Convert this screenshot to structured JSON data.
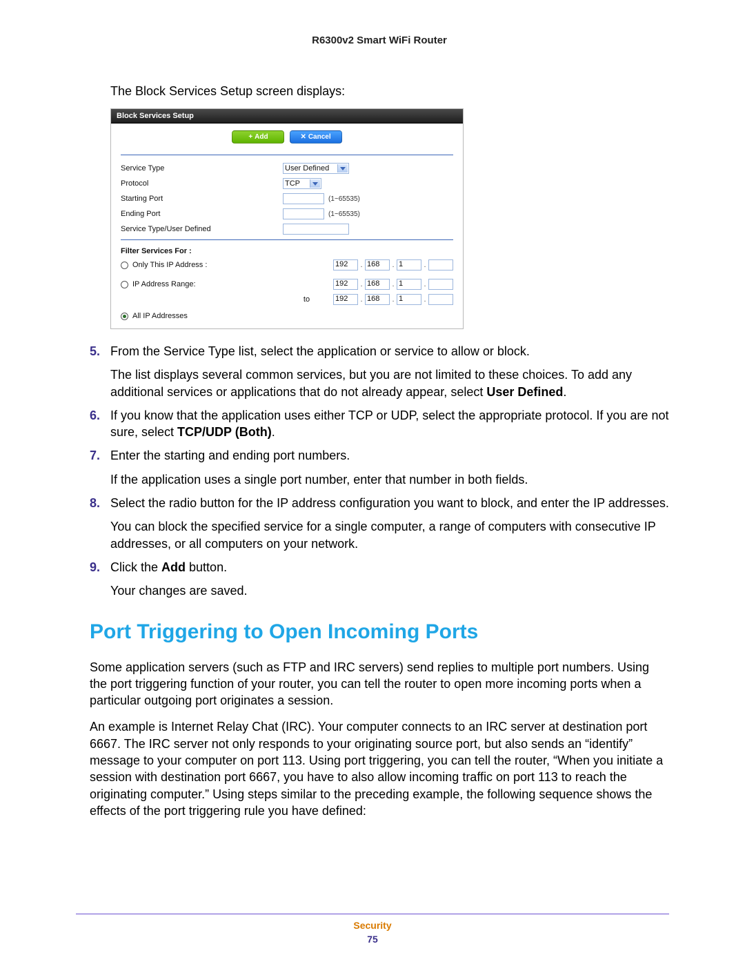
{
  "doc_header": "R6300v2 Smart WiFi Router",
  "intro": "The Block Services Setup screen displays:",
  "panel": {
    "title": "Block Services Setup",
    "buttons": {
      "add": "Add",
      "cancel": "Cancel"
    },
    "rows": {
      "service_type": {
        "label": "Service Type",
        "value": "User Defined"
      },
      "protocol": {
        "label": "Protocol",
        "value": "TCP"
      },
      "starting_port": {
        "label": "Starting Port",
        "value": "",
        "hint": "(1~65535)"
      },
      "ending_port": {
        "label": "Ending Port",
        "value": "",
        "hint": "(1~65535)"
      },
      "user_defined": {
        "label": "Service Type/User Defined",
        "value": ""
      }
    },
    "filter_label": "Filter Services For :",
    "radios": {
      "only_this": "Only This IP Address :",
      "range": "IP Address Range:",
      "all": "All IP Addresses"
    },
    "ip": {
      "only": [
        "192",
        "168",
        "1",
        ""
      ],
      "range_from": [
        "192",
        "168",
        "1",
        ""
      ],
      "range_to_label": "to",
      "range_to": [
        "192",
        "168",
        "1",
        ""
      ]
    }
  },
  "steps": [
    {
      "num": "5.",
      "paras": [
        [
          {
            "t": "From the Service Type list, select the application or service to allow or block."
          }
        ],
        [
          {
            "t": "The list displays several common services, but you are not limited to these choices. To add any additional services or applications that do not already appear, select "
          },
          {
            "t": "User Defined",
            "b": true
          },
          {
            "t": "."
          }
        ]
      ]
    },
    {
      "num": "6.",
      "paras": [
        [
          {
            "t": "If you know that the application uses either TCP or UDP, select the appropriate protocol. If you are not sure, select "
          },
          {
            "t": "TCP/UDP (Both)",
            "b": true
          },
          {
            "t": "."
          }
        ]
      ]
    },
    {
      "num": "7.",
      "paras": [
        [
          {
            "t": "Enter the starting and ending port numbers."
          }
        ],
        [
          {
            "t": "If the application uses a single port number, enter that number in both fields."
          }
        ]
      ]
    },
    {
      "num": "8.",
      "paras": [
        [
          {
            "t": "Select the radio button for the IP address configuration you want to block, and enter the IP addresses."
          }
        ],
        [
          {
            "t": "You can block the specified service for a single computer, a range of computers with consecutive IP addresses, or all computers on your network."
          }
        ]
      ]
    },
    {
      "num": "9.",
      "paras": [
        [
          {
            "t": "Click the "
          },
          {
            "t": "Add",
            "b": true
          },
          {
            "t": " button."
          }
        ],
        [
          {
            "t": "Your changes are saved."
          }
        ]
      ]
    }
  ],
  "heading": "Port Triggering to Open Incoming Ports",
  "body_paras": [
    "Some application servers (such as FTP and IRC servers) send replies to multiple port numbers. Using the port triggering function of your router, you can tell the router to open more incoming ports when a particular outgoing port originates a session.",
    "An example is Internet Relay Chat (IRC). Your computer connects to an IRC server at destination port 6667. The IRC server not only responds to your originating source port, but also sends an “identify” message to your computer on port 113. Using port triggering, you can tell the router, “When you initiate a session with destination port 6667, you have to also allow incoming traffic on port 113 to reach the originating computer.” Using steps similar to the preceding example, the following sequence shows the effects of the port triggering rule you have defined:"
  ],
  "footer": {
    "section": "Security",
    "page": "75"
  }
}
